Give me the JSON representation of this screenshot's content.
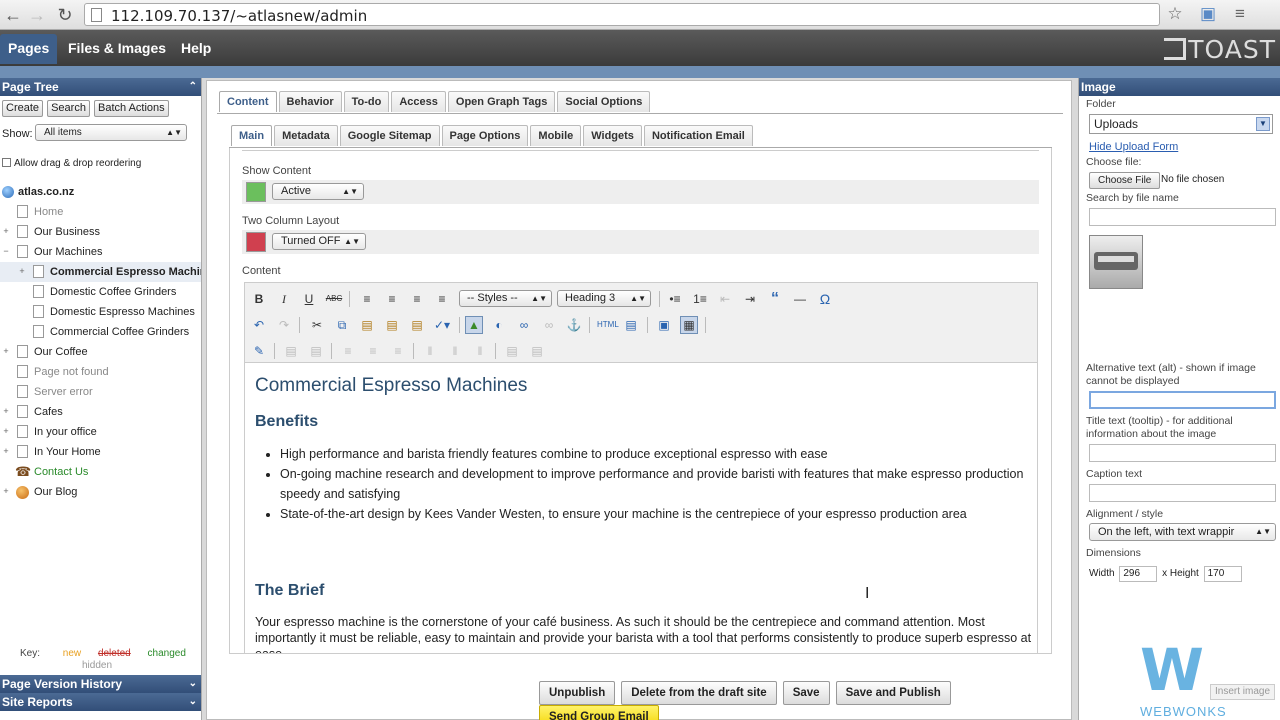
{
  "browser": {
    "url": "112.109.70.137/~atlasnew/admin",
    "icons": [
      "back-icon",
      "forward-icon",
      "reload-icon",
      "star-icon",
      "extension-icon",
      "menu-icon"
    ]
  },
  "topnav": {
    "tabs": [
      "Pages",
      "Files & Images",
      "Help"
    ],
    "logo": "TOAST"
  },
  "left": {
    "page_tree_title": "Page Tree",
    "buttons": [
      "Create",
      "Search",
      "Batch Actions"
    ],
    "show_label": "Show:",
    "show_value": "All items",
    "drag_label": "Allow drag & drop reordering",
    "root": "atlas.co.nz",
    "tree": [
      {
        "label": "Home",
        "style": "grey"
      },
      {
        "label": "Our Business",
        "style": "normal"
      },
      {
        "label": "Our Machines",
        "style": "normal"
      },
      {
        "label": "Commercial Espresso Machines",
        "style": "selected"
      },
      {
        "label": "Domestic Coffee Grinders",
        "style": "normal"
      },
      {
        "label": "Domestic Espresso Machines",
        "style": "normal"
      },
      {
        "label": "Commercial Coffee Grinders",
        "style": "normal"
      },
      {
        "label": "Our Coffee",
        "style": "normal"
      },
      {
        "label": "Page not found",
        "style": "grey"
      },
      {
        "label": "Server error",
        "style": "grey"
      },
      {
        "label": "Cafes",
        "style": "normal"
      },
      {
        "label": "In your office",
        "style": "normal"
      },
      {
        "label": "In Your Home",
        "style": "normal"
      },
      {
        "label": "Contact Us",
        "style": "green"
      },
      {
        "label": "Our Blog",
        "style": "normal"
      }
    ],
    "key_label": "Key:",
    "key_new": "new",
    "key_deleted": "deleted",
    "key_changed": "changed",
    "key_hidden": "hidden",
    "version_history": "Page Version History",
    "site_reports": "Site Reports"
  },
  "main": {
    "tabs": [
      "Content",
      "Behavior",
      "To-do",
      "Access",
      "Open Graph Tags",
      "Social Options"
    ],
    "subtabs": [
      "Main",
      "Metadata",
      "Google Sitemap",
      "Page Options",
      "Mobile",
      "Widgets",
      "Notification Email"
    ],
    "show_content_label": "Show Content",
    "show_content_value": "Active",
    "show_content_color": "#5cb85c",
    "two_col_label": "Two Column Layout",
    "two_col_value": "Turned OFF",
    "two_col_color": "#d9534f",
    "content_label": "Content",
    "toolbar": {
      "styles": "-- Styles --",
      "format": "Heading 3",
      "bold": "B",
      "italic": "I",
      "underline": "U",
      "strike": "ABC",
      "omega": "Ω",
      "quote": "“"
    },
    "editor": {
      "h1": "Commercial Espresso Machines",
      "h2_benefits": "Benefits",
      "benefits": [
        "High performance and barista friendly features combine to produce exceptional espresso with ease",
        "On-going machine research and development to improve performance and provide baristi with features that make espresso production speedy and satisfying",
        "State-of-the-art design by Kees Vander Westen, to ensure your machine is the centrepiece of your espresso production area"
      ],
      "h2_brief": "The Brief",
      "brief": "Your espresso machine is the cornerstone of your café business. As such it should be the centrepiece and command attention. Most importantly it must be reliable, easy to maintain and provide your barista with a tool that performs consistently to produce superb espresso at ease."
    },
    "buttons": [
      "Unpublish",
      "Delete from the draft site",
      "Save",
      "Save and Publish",
      "Send Group Email"
    ]
  },
  "right": {
    "title": "Image",
    "folder_label": "Folder",
    "folder_value": "Uploads",
    "hide_upload": "Hide Upload Form",
    "choose_file_label": "Choose file:",
    "choose_file_button": "Choose File",
    "no_file": "No file chosen",
    "search_label": "Search by file name",
    "alt_label": "Alternative text (alt) - shown if image cannot be displayed",
    "title_label": "Title text (tooltip) - for additional information about the image",
    "caption_label": "Caption text",
    "align_label": "Alignment / style",
    "align_value": "On the left, with text wrappir",
    "dimensions_label": "Dimensions",
    "width_label": "Width",
    "width_value": "296",
    "height_label": "x Height",
    "height_value": "170",
    "insert_image": "Insert image"
  },
  "watermark": {
    "letter": "W",
    "text": "WEBWONKS"
  }
}
